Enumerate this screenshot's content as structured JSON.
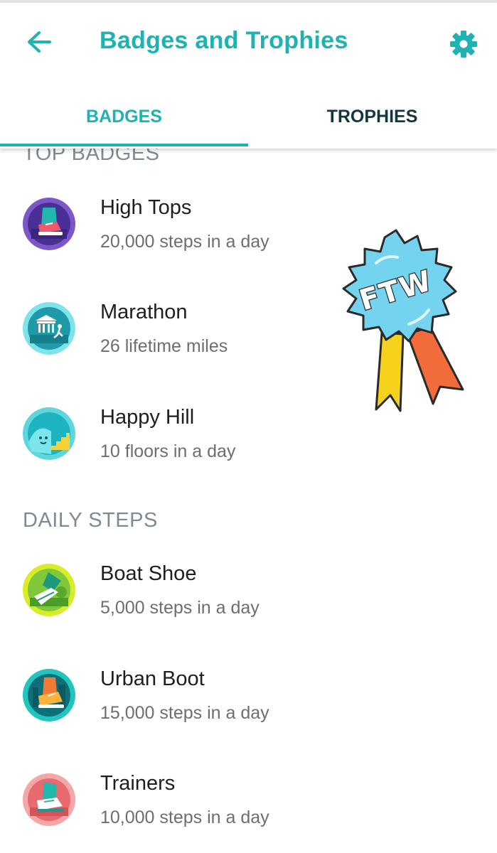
{
  "header": {
    "title": "Badges and Trophies",
    "back_icon": "arrow-left-icon",
    "settings_icon": "gear-icon"
  },
  "tabs": [
    {
      "label": "BADGES",
      "selected": true
    },
    {
      "label": "TROPHIES",
      "selected": false
    }
  ],
  "sections": [
    {
      "title": "TOP BADGES",
      "items": [
        {
          "name": "High Tops",
          "detail": "20,000 steps in a day",
          "icon": "high-tops-badge-icon"
        },
        {
          "name": "Marathon",
          "detail": "26 lifetime miles",
          "icon": "marathon-badge-icon"
        },
        {
          "name": "Happy Hill",
          "detail": "10 floors in a day",
          "icon": "happy-hill-badge-icon"
        }
      ]
    },
    {
      "title": "DAILY STEPS",
      "items": [
        {
          "name": "Boat Shoe",
          "detail": "5,000 steps in a day",
          "icon": "boat-shoe-badge-icon"
        },
        {
          "name": "Urban Boot",
          "detail": "15,000 steps in a day",
          "icon": "urban-boot-badge-icon"
        },
        {
          "name": "Trainers",
          "detail": "10,000 steps in a day",
          "icon": "trainers-badge-icon"
        }
      ]
    }
  ],
  "sticker": {
    "text": "FTW",
    "icon": "ribbon-rosette-icon"
  },
  "colors": {
    "accent": "#1fb2b2",
    "tab_inactive": "#143640",
    "section_header": "#808a93",
    "title_text": "#1e1e1e",
    "subtitle_text": "#6e6e6e"
  }
}
